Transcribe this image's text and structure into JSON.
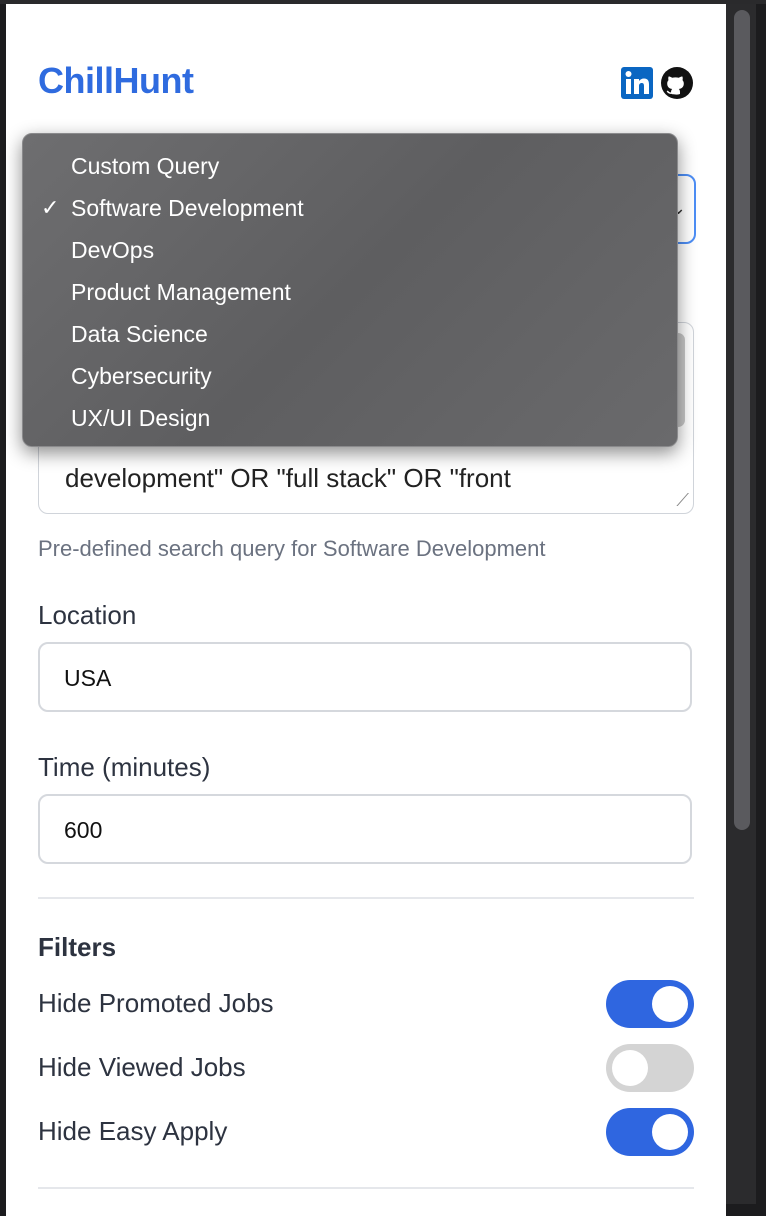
{
  "app": {
    "brand": "ChillHunt",
    "icons": {
      "linkedin": "linkedin-icon",
      "github": "github-icon"
    }
  },
  "query": {
    "text": "development\" OR \"full stack\" OR \"front",
    "help": "Pre-defined search query for Software Development"
  },
  "location": {
    "label": "Location",
    "value": "USA"
  },
  "time": {
    "label": "Time (minutes)",
    "value": "600"
  },
  "filters": {
    "title": "Filters",
    "items": [
      {
        "label": "Hide Promoted Jobs",
        "on": true
      },
      {
        "label": "Hide Viewed Jobs",
        "on": false
      },
      {
        "label": "Hide Easy Apply",
        "on": true
      }
    ]
  },
  "dropdown": {
    "selected": "Software Development",
    "options": [
      "Custom Query",
      "Software Development",
      "DevOps",
      "Product Management",
      "Data Science",
      "Cybersecurity",
      "UX/UI Design"
    ]
  },
  "colors": {
    "brand": "#2f6bdf",
    "toggle_on": "#2f66e0",
    "toggle_off": "#d4d4d4"
  }
}
